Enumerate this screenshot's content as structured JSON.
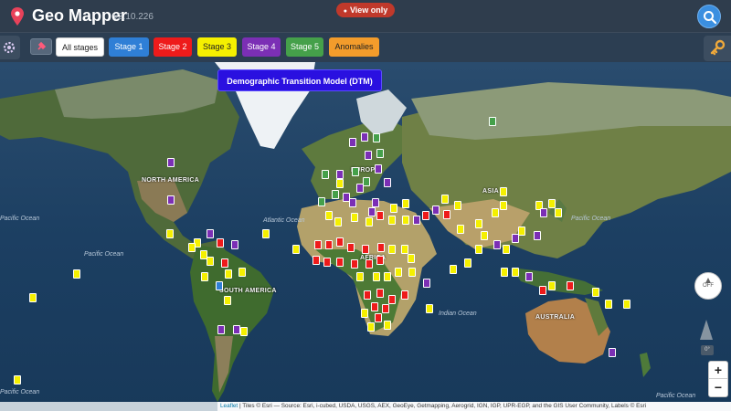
{
  "app": {
    "title": "Geo Mapper",
    "version": "v2.10.226",
    "view_mode": "View only"
  },
  "stages": [
    {
      "label": "All stages",
      "bg": "#ffffff",
      "fg": "#222222"
    },
    {
      "label": "Stage 1",
      "bg": "#2f7fd6",
      "fg": "#ffffff"
    },
    {
      "label": "Stage 2",
      "bg": "#ee1b1b",
      "fg": "#ffffff"
    },
    {
      "label": "Stage 3",
      "bg": "#f5f000",
      "fg": "#222222"
    },
    {
      "label": "Stage 4",
      "bg": "#7b2fb5",
      "fg": "#ffffff"
    },
    {
      "label": "Stage 5",
      "bg": "#45a04a",
      "fg": "#ffffff"
    },
    {
      "label": "Anomalies",
      "bg": "#f39c2b",
      "fg": "#222222"
    }
  ],
  "map": {
    "title": "Demographic Transition Model (DTM)",
    "ocean_labels": [
      "Pacific Ocean",
      "Pacific Ocean",
      "Atlantic Ocean",
      "Indian Ocean",
      "Pacific Ocean",
      "Pacific Ocean",
      "Pacific Ocean"
    ],
    "continent_labels": [
      "NORTH AMERICA",
      "SOUTH AMERICA",
      "AFRICA",
      "ASIA",
      "EUROPE",
      "AUSTRALIA"
    ],
    "compass_label": "OFF",
    "tilt_label": "0°",
    "zoom_in": "+",
    "zoom_out": "−",
    "attribution_link": "Leaflet",
    "attribution_text": " | Tiles © Esri — Source: Esri, i-cubed, USDA, USGS, AEX, GeoEye, Getmapping, Aerogrid, IGN, IGP, UPR-EGP, and the GIS User Community, Labels © Esri"
  },
  "colors": {
    "stage1": "#2f7fd6",
    "stage2": "#ee1b1b",
    "stage3": "#f5f000",
    "stage4": "#7b2fb5",
    "stage5": "#45a04a",
    "anomaly": "#f39c2b"
  }
}
